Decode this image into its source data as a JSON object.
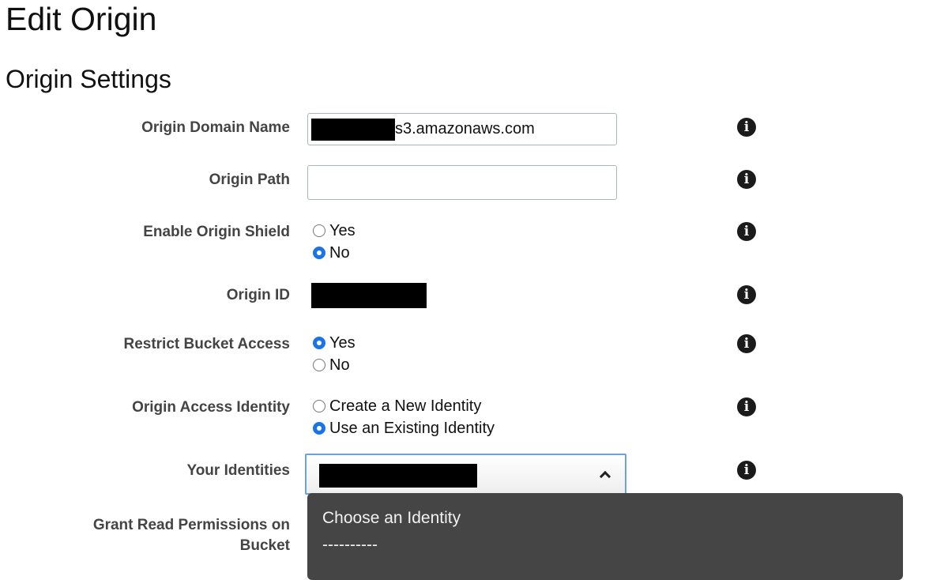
{
  "page": {
    "title": "Edit Origin",
    "section_title": "Origin Settings"
  },
  "fields": {
    "origin_domain_name": {
      "label": "Origin Domain Name",
      "value_visible": "s3.amazonaws.com"
    },
    "origin_path": {
      "label": "Origin Path",
      "value": ""
    },
    "enable_origin_shield": {
      "label": "Enable Origin Shield",
      "options": [
        "Yes",
        "No"
      ],
      "selected": "No"
    },
    "origin_id": {
      "label": "Origin ID"
    },
    "restrict_bucket_access": {
      "label": "Restrict Bucket Access",
      "options": [
        "Yes",
        "No"
      ],
      "selected": "Yes"
    },
    "origin_access_identity": {
      "label": "Origin Access Identity",
      "options": [
        "Create a New Identity",
        "Use an Existing Identity"
      ],
      "selected": "Use an Existing Identity"
    },
    "your_identities": {
      "label": "Your Identities",
      "dropdown_options": [
        "Choose an Identity",
        "----------"
      ]
    },
    "grant_read_permissions": {
      "label_line1": "Grant Read Permissions on",
      "label_line2": "Bucket"
    }
  },
  "icons": {
    "info": "info-icon",
    "chevron": "chevron-up-icon"
  },
  "colors": {
    "radio_selected": "#1a73e8",
    "dropdown_bg": "#454545",
    "select_focus_border": "#6fa0d8"
  }
}
